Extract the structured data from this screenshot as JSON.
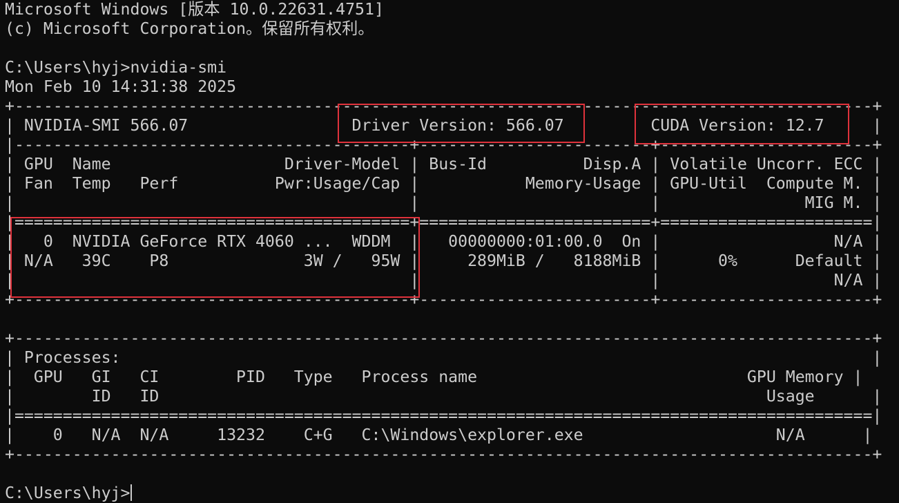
{
  "header": {
    "os_version": "Microsoft Windows [版本 10.0.22631.4751]",
    "copyright": "(c) Microsoft Corporation。保留所有权利。"
  },
  "command": {
    "prompt": "C:\\Users\\hyj>",
    "text": "nvidia-smi"
  },
  "timestamp": "Mon Feb 10 14:31:38 2025",
  "smi_table": {
    "border_top": "+-----------------------------------------------------------------------------------------+",
    "summary_row": "| NVIDIA-SMI 566.07                 Driver Version: 566.07         CUDA Version: 12.7     |",
    "sep_header": "|-----------------------------------------+------------------------+----------------------+",
    "header_row_1": "| GPU  Name                  Driver-Model | Bus-Id          Disp.A | Volatile Uncorr. ECC |",
    "header_row_2": "| Fan  Temp   Perf          Pwr:Usage/Cap |           Memory-Usage | GPU-Util  Compute M. |",
    "header_row_3": "|                                         |                        |               MIG M. |",
    "sep_double": "|=========================================+========================+======================|",
    "gpu_row_1": "|   0  NVIDIA GeForce RTX 4060 ...  WDDM  |   00000000:01:00.0  On |                  N/A |",
    "gpu_row_2": "| N/A   39C    P8              3W /   95W |     289MiB /   8188MiB |      0%      Default |",
    "gpu_row_3": "|                                         |                        |                  N/A |",
    "border_bottom": "+-----------------------------------------+------------------------+----------------------+"
  },
  "processes_table": {
    "border_top": "+-----------------------------------------------------------------------------------------+",
    "title_row": "| Processes:                                                                              |",
    "header_row_1": "|  GPU   GI   CI        PID   Type   Process name                            GPU Memory |",
    "header_row_2": "|        ID   ID                                                               Usage      |",
    "sep_double": "|=========================================================================================|",
    "proc_row_1": "|    0   N/A  N/A     13232    C+G   C:\\Windows\\explorer.exe                    N/A      |",
    "border_bottom": "+-----------------------------------------------------------------------------------------+"
  },
  "final_prompt": "C:\\Users\\hyj>",
  "colors": {
    "background": "#0c0c0c",
    "text": "#cccccc",
    "highlight_box": "#e0323c"
  }
}
